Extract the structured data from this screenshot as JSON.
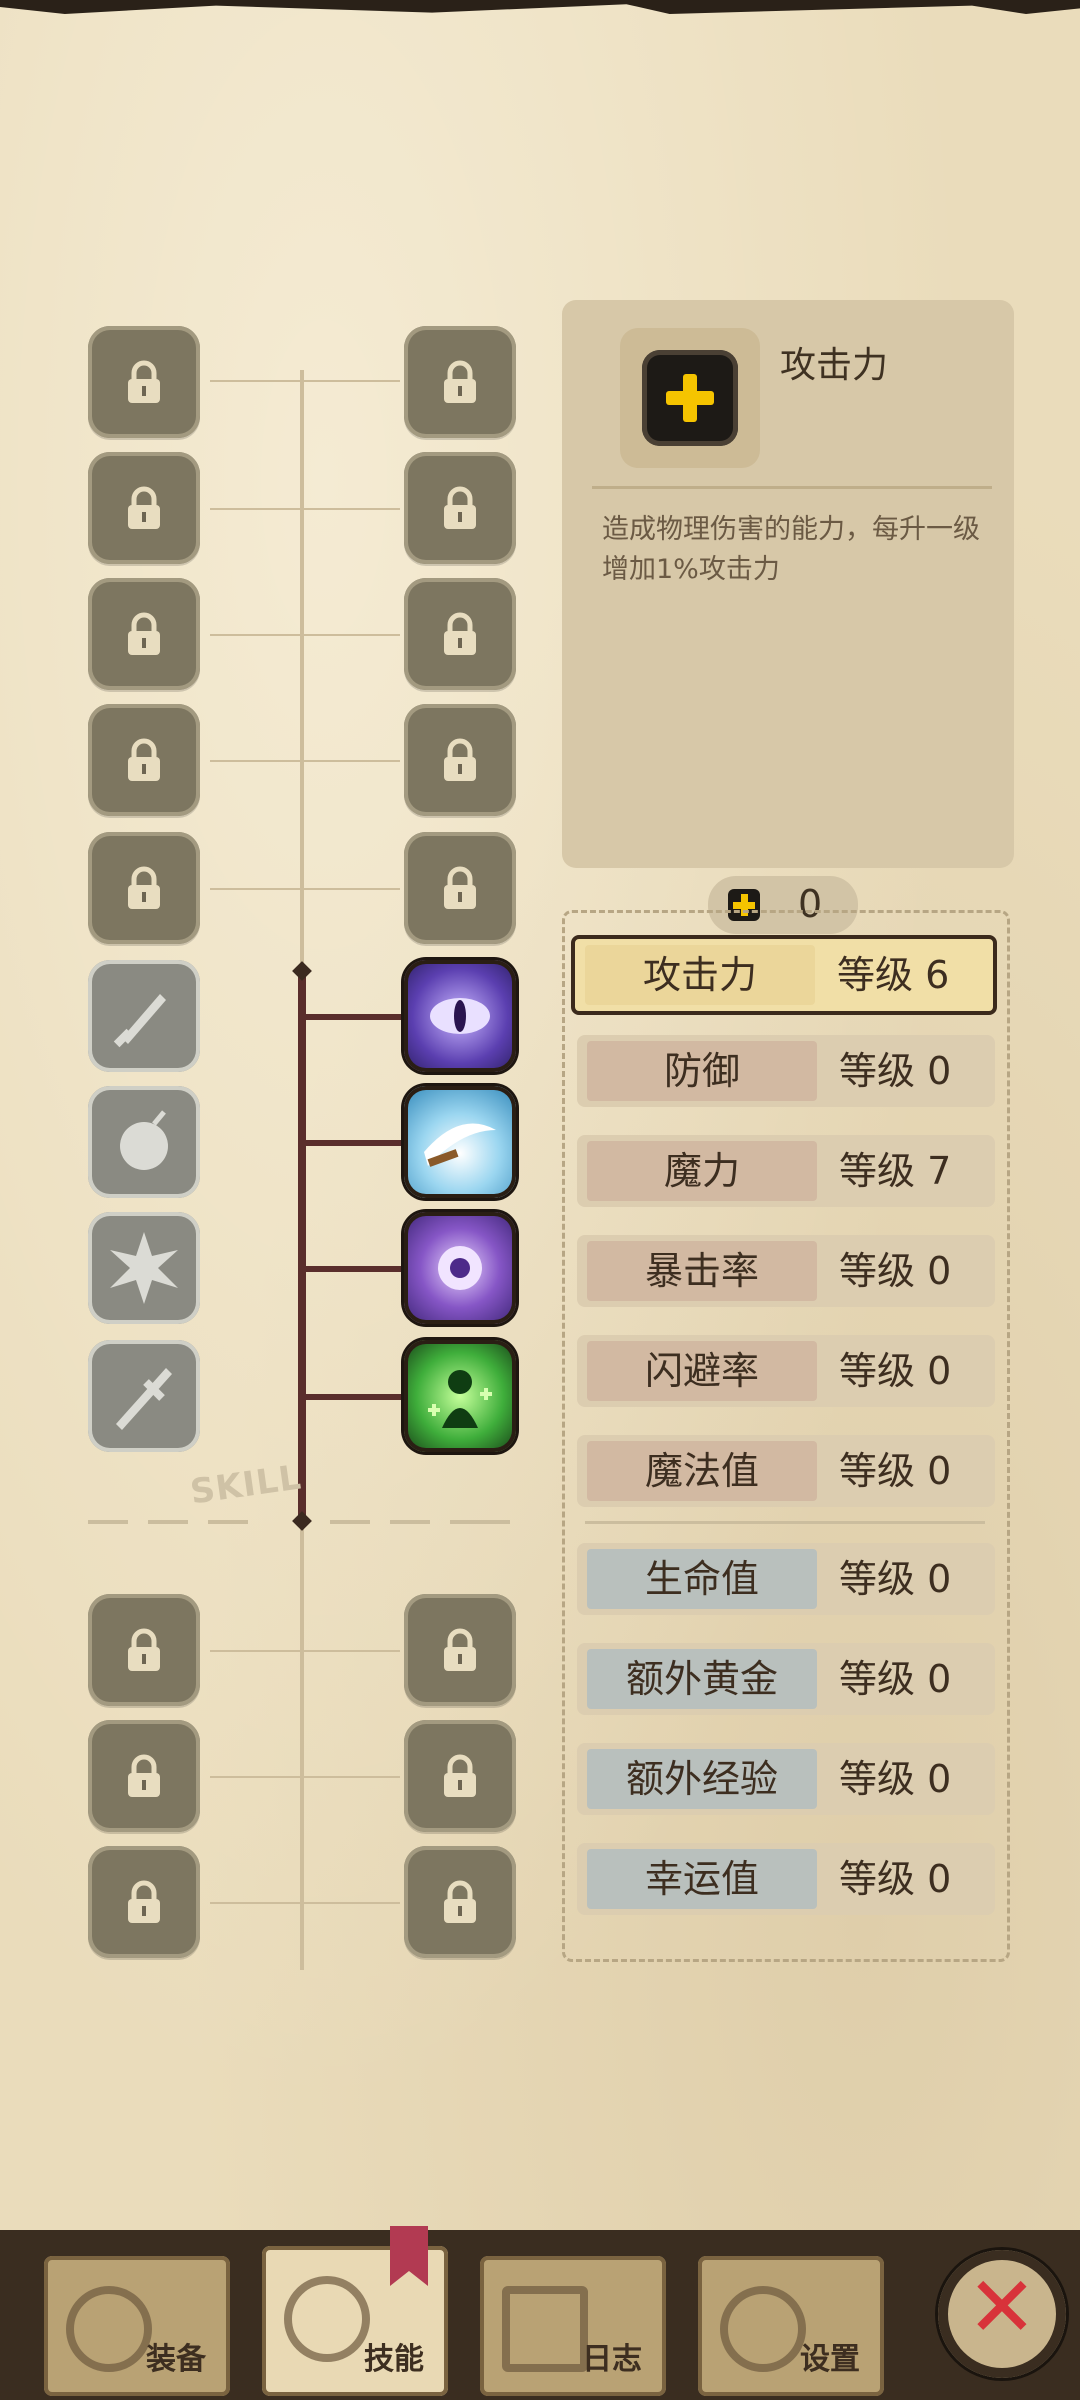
{
  "info": {
    "title": "攻击力",
    "description": "造成物理伤害的能力，每升一级增加1%攻击力",
    "icon": "plus-icon"
  },
  "points": {
    "value": "0",
    "icon": "plus-icon"
  },
  "skill_tree_label": "SKILL",
  "stats": [
    {
      "name": "攻击力",
      "level": "等级 6",
      "selected": true
    },
    {
      "name": "防御",
      "level": "等级 0"
    },
    {
      "name": "魔力",
      "level": "等级 7"
    },
    {
      "name": "暴击率",
      "level": "等级 0"
    },
    {
      "name": "闪避率",
      "level": "等级 0"
    },
    {
      "name": "魔法值",
      "level": "等级 0"
    },
    {
      "name": "生命值",
      "level": "等级 0"
    },
    {
      "name": "额外黄金",
      "level": "等级 0"
    },
    {
      "name": "额外经验",
      "level": "等级 0"
    },
    {
      "name": "幸运值",
      "level": "等级 0"
    }
  ],
  "tabs": [
    {
      "label": "装备",
      "icon": "axe-icon"
    },
    {
      "label": "技能",
      "icon": "skill-icon",
      "active": true
    },
    {
      "label": "日志",
      "icon": "journal-icon"
    },
    {
      "label": "设置",
      "icon": "gear-icon"
    }
  ],
  "close_label": "✕",
  "colors": {
    "accent": "#f5c400",
    "tree_line": "#5a2e2c",
    "close": "#d8323a"
  }
}
